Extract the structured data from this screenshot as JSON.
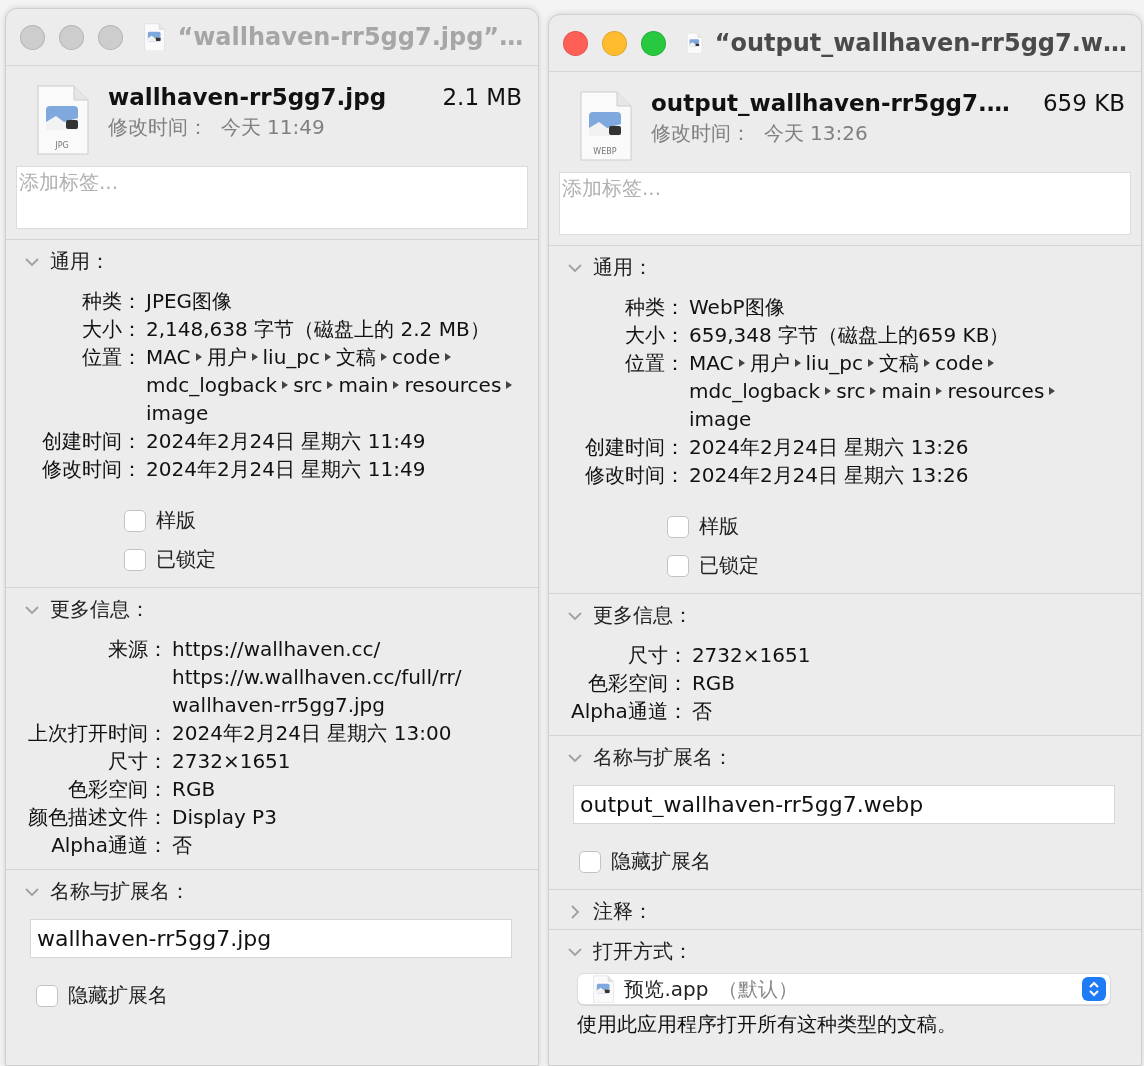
{
  "windows": [
    {
      "title": "“wallhaven-rr5gg7.jpg”…",
      "active": false,
      "file_type": "JPG",
      "file_name": "wallhaven-rr5gg7.jpg",
      "size": "2.1 MB",
      "modified": "修改时间：  今天 11:49",
      "tags_placeholder": "添加标签...",
      "sections": [
        {
          "kind": "info",
          "title": "通用：",
          "expanded": true,
          "rows": [
            {
              "kind": "text",
              "label": "种类：",
              "value": "JPEG图像"
            },
            {
              "kind": "text",
              "label": "大小：",
              "value": "2,148,638 字节（磁盘上的 2.2 MB）"
            },
            {
              "kind": "path",
              "label": "位置：",
              "path": [
                "MAC",
                "用户",
                "liu_pc",
                "文稿",
                "code",
                "mdc_logback",
                "src",
                "main",
                "resources",
                "image"
              ]
            },
            {
              "kind": "text",
              "label": "创建时间：",
              "value": "2024年2月24日 星期六 11:49"
            },
            {
              "kind": "text",
              "label": "修改时间：",
              "value": "2024年2月24日 星期六 11:49"
            }
          ],
          "checkboxes": [
            {
              "label": "样版",
              "checked": false
            },
            {
              "label": "已锁定",
              "checked": false
            }
          ]
        },
        {
          "kind": "info",
          "title": "更多信息：",
          "expanded": true,
          "rows": [
            {
              "kind": "text",
              "label": "来源：",
              "value": "https://wallhaven.cc/ https://w.wallhaven.cc/full/rr/ wallhaven-rr5gg7.jpg"
            },
            {
              "kind": "text",
              "label": "上次打开时间：",
              "value": "2024年2月24日 星期六 13:00"
            },
            {
              "kind": "text",
              "label": "尺寸：",
              "value": "2732×1651"
            },
            {
              "kind": "text",
              "label": "色彩空间：",
              "value": "RGB"
            },
            {
              "kind": "text",
              "label": "颜色描述文件：",
              "value": "Display P3"
            },
            {
              "kind": "text",
              "label": "Alpha通道：",
              "value": "否"
            }
          ]
        },
        {
          "kind": "name",
          "title": "名称与扩展名：",
          "expanded": true,
          "value": "wallhaven-rr5gg7.jpg",
          "checkboxes": [
            {
              "label": "隐藏扩展名",
              "checked": false
            }
          ]
        }
      ]
    },
    {
      "title": "“output_wallhaven-rr5gg7.w…",
      "active": true,
      "file_type": "WEBP",
      "file_name": "output_wallhaven-rr5gg7.…",
      "size": "659 KB",
      "modified": "修改时间：  今天 13:26",
      "tags_placeholder": "添加标签...",
      "sections": [
        {
          "kind": "info",
          "title": "通用：",
          "expanded": true,
          "rows": [
            {
              "kind": "text",
              "label": "种类：",
              "value": "WebP图像"
            },
            {
              "kind": "text",
              "label": "大小：",
              "value": "659,348 字节（磁盘上的659 KB）"
            },
            {
              "kind": "path",
              "label": "位置：",
              "path": [
                "MAC",
                "用户",
                "liu_pc",
                "文稿",
                "code",
                "mdc_logback",
                "src",
                "main",
                "resources",
                "image"
              ]
            },
            {
              "kind": "text",
              "label": "创建时间：",
              "value": "2024年2月24日 星期六 13:26"
            },
            {
              "kind": "text",
              "label": "修改时间：",
              "value": "2024年2月24日 星期六 13:26"
            }
          ],
          "checkboxes": [
            {
              "label": "样版",
              "checked": false
            },
            {
              "label": "已锁定",
              "checked": false
            }
          ]
        },
        {
          "kind": "info",
          "title": "更多信息：",
          "expanded": true,
          "rows": [
            {
              "kind": "text",
              "label": "尺寸：",
              "value": "2732×1651"
            },
            {
              "kind": "text",
              "label": "色彩空间：",
              "value": "RGB"
            },
            {
              "kind": "text",
              "label": "Alpha通道：",
              "value": "否"
            }
          ]
        },
        {
          "kind": "name",
          "title": "名称与扩展名：",
          "expanded": true,
          "value": "output_wallhaven-rr5gg7.webp",
          "checkboxes": [
            {
              "label": "隐藏扩展名",
              "checked": false
            }
          ]
        },
        {
          "kind": "comments",
          "title": "注释：",
          "expanded": false
        },
        {
          "kind": "open_with",
          "title": "打开方式：",
          "expanded": true,
          "app": "预览.app",
          "note": "（默认）",
          "hint": "使用此应用程序打开所有这种类型的文稿。"
        }
      ]
    }
  ]
}
